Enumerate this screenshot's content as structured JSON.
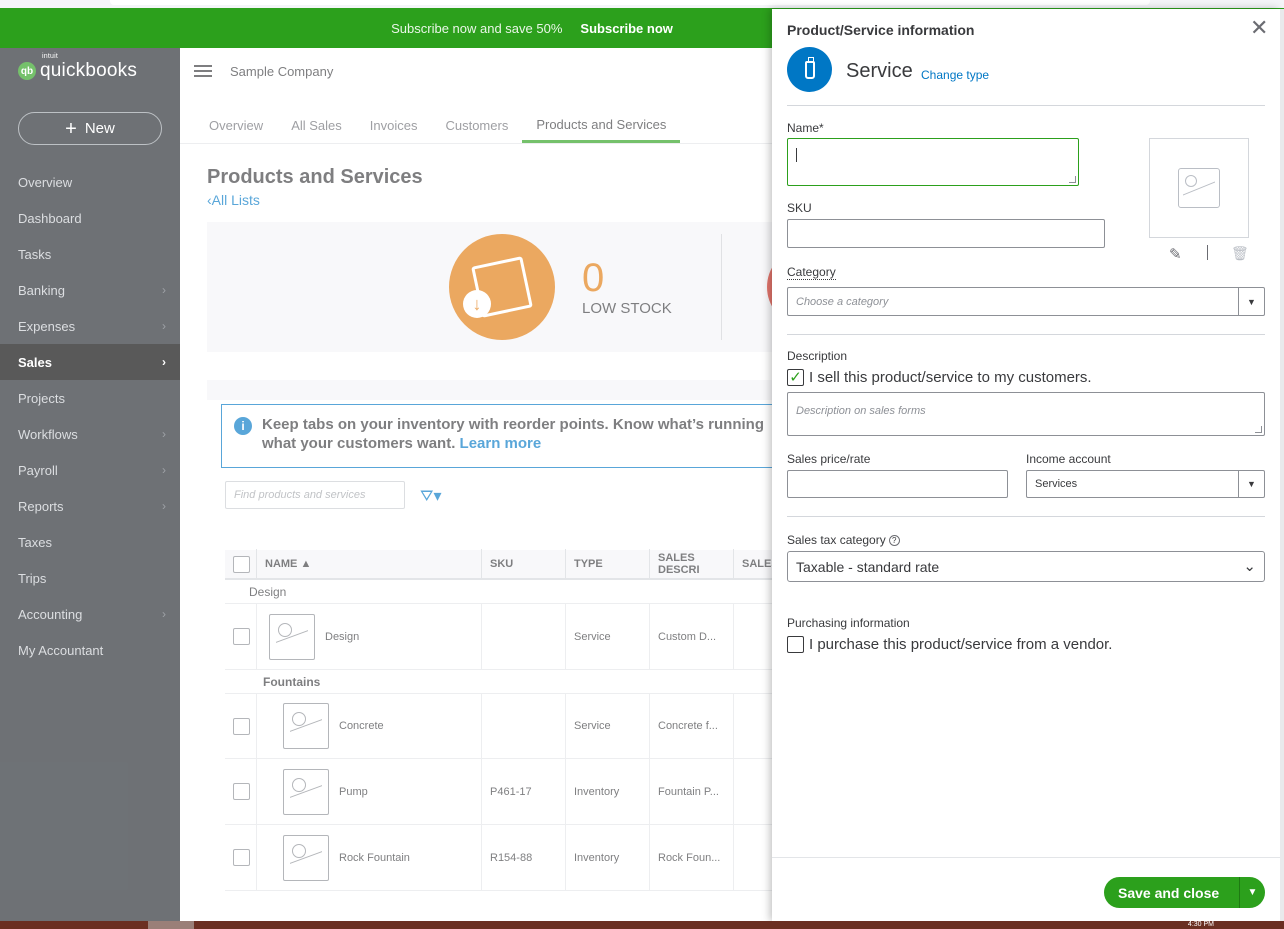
{
  "promo": {
    "text": "Subscribe now and save 50%",
    "cta": "Subscribe now"
  },
  "sidebar": {
    "logo_badge": "qb",
    "brand": "quickbooks",
    "brand_super": "intuit",
    "new_label": "New",
    "items": [
      {
        "label": "Overview",
        "arrow": false
      },
      {
        "label": "Dashboard",
        "arrow": false
      },
      {
        "label": "Tasks",
        "arrow": false
      },
      {
        "label": "Banking",
        "arrow": true
      },
      {
        "label": "Expenses",
        "arrow": true
      },
      {
        "label": "Sales",
        "arrow": true,
        "active": true
      },
      {
        "label": "Projects",
        "arrow": false
      },
      {
        "label": "Workflows",
        "arrow": true
      },
      {
        "label": "Payroll",
        "arrow": true
      },
      {
        "label": "Reports",
        "arrow": true
      },
      {
        "label": "Taxes",
        "arrow": false
      },
      {
        "label": "Trips",
        "arrow": false
      },
      {
        "label": "Accounting",
        "arrow": true
      },
      {
        "label": "My Accountant",
        "arrow": false
      }
    ]
  },
  "header": {
    "company": "Sample Company"
  },
  "tabs": [
    "Overview",
    "All Sales",
    "Invoices",
    "Customers",
    "Products and Services"
  ],
  "page": {
    "title": "Products and Services",
    "back_link": "All Lists",
    "low_stock_count": "0",
    "low_stock_label": "LOW STOCK",
    "info_text": "Keep tabs on your inventory with reorder points. Know what’s running",
    "info_text2": "what your customers want.",
    "info_link": "Learn more",
    "search_placeholder": "Find products and services"
  },
  "table": {
    "columns": [
      "NAME ▲",
      "SKU",
      "TYPE",
      "SALES DESCRI",
      "SALES"
    ],
    "groups": [
      {
        "label": "Design",
        "rows": [
          {
            "name": "Design",
            "sku": "",
            "type": "Service",
            "desc": "Custom D..."
          }
        ]
      },
      {
        "label": "Fountains",
        "rows": [
          {
            "name": "Concrete",
            "sku": "",
            "type": "Service",
            "desc": "Concrete f..."
          },
          {
            "name": "Pump",
            "sku": "P461-17",
            "type": "Inventory",
            "desc": "Fountain P..."
          },
          {
            "name": "Rock Fountain",
            "sku": "R154-88",
            "type": "Inventory",
            "desc": "Rock Foun..."
          }
        ]
      }
    ]
  },
  "drawer": {
    "title": "Product/Service information",
    "type": "Service",
    "change_type": "Change type",
    "name_label": "Name*",
    "sku_label": "SKU",
    "category_label": "Category",
    "category_placeholder": "Choose a category",
    "description_label": "Description",
    "sell_checkbox_label": "I sell this product/service to my customers.",
    "description_placeholder": "Description on sales forms",
    "price_label": "Sales price/rate",
    "income_label": "Income account",
    "income_value": "Services",
    "tax_label": "Sales tax category",
    "tax_help": "?",
    "tax_value": "Taxable - standard rate",
    "purchasing_label": "Purchasing information",
    "purchase_checkbox_label": "I purchase this product/service from a vendor.",
    "save_label": "Save and close"
  },
  "taskbar": {
    "clock": "4:30 PM"
  },
  "colors": {
    "brand_green": "#2ca01c",
    "link_blue": "#0077c5",
    "sidebar_bg": "#21262c",
    "stock_orange": "#e17a0c"
  }
}
